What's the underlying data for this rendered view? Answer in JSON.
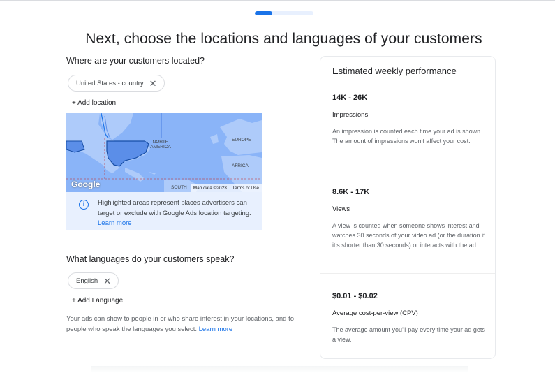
{
  "progress": {
    "fraction": 0.3
  },
  "page_title": "Next, choose the locations and languages of your customers",
  "locations": {
    "heading": "Where are your customers located?",
    "chip_label": "United States - country",
    "add_label": "+ Add location",
    "map": {
      "labels": {
        "north_america": "NORTH AMERICA",
        "europe": "EUROPE",
        "africa": "AFRICA",
        "south": "SOUTH"
      },
      "logo_text": "Google",
      "attribution": "Map data ©2023",
      "terms": "Terms of Use"
    },
    "info_text": "Highlighted areas represent places advertisers can target or exclude with Google Ads location targeting.",
    "info_link": "Learn more"
  },
  "languages": {
    "heading": "What languages do your customers speak?",
    "chip_label": "English",
    "add_label": "+ Add Language"
  },
  "footnote": {
    "text": "Your ads can show to people in or who share interest in your locations, and to people who speak the languages you select.",
    "link": "Learn more"
  },
  "performance": {
    "title": "Estimated weekly performance",
    "metrics": [
      {
        "range": "14K - 26K",
        "label": "Impressions",
        "description": "An impression is counted each time your ad is shown. The amount of impressions won't affect your cost."
      },
      {
        "range": "8.6K - 17K",
        "label": "Views",
        "description": "A view is counted when someone shows interest and watches 30 seconds of your video ad (or the duration if it's shorter than 30 seconds) or interacts with the ad."
      },
      {
        "range": "$0.01 - $0.02",
        "label": "Average cost-per-view (CPV)",
        "description": "The average amount you'll pay every time your ad gets a view."
      }
    ]
  },
  "colors": {
    "accent": "#1a73e8",
    "map_water": "#8ab4f8",
    "info_bg": "#e8f0fe"
  },
  "icons": {
    "remove": "close-icon",
    "info": "info-icon"
  }
}
